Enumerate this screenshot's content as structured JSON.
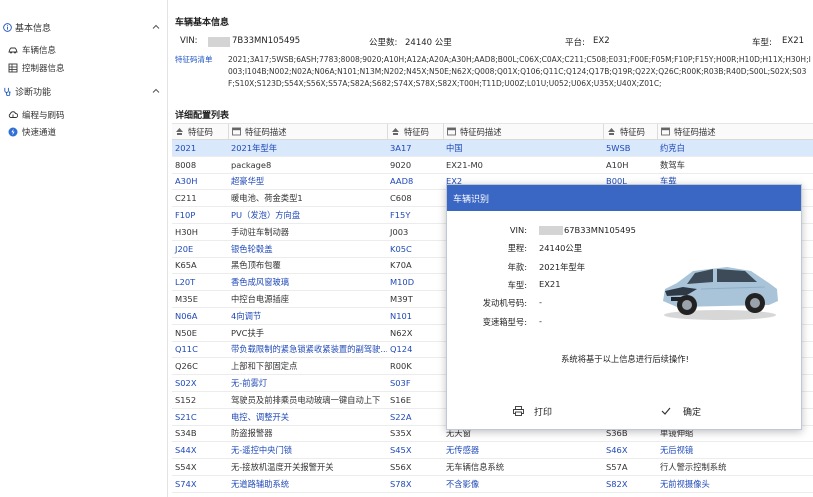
{
  "sidebar": {
    "sections": [
      {
        "label": "基本信息",
        "items": [
          {
            "label": "车辆信息"
          },
          {
            "label": "控制器信息"
          }
        ]
      },
      {
        "label": "诊断功能",
        "items": [
          {
            "label": "编程与刷码"
          },
          {
            "label": "快速通道"
          }
        ]
      }
    ]
  },
  "vehicle_info": {
    "title": "车辆基本信息",
    "vin_label": "VIN:",
    "vin_partial": "7B33MN105495",
    "mileage_label": "公里数:",
    "mileage_value": "24140 公里",
    "platform_label": "平台:",
    "platform_value": "EX2",
    "model_label": "车型:",
    "model_value": "EX21",
    "code_label": "特征码清单",
    "code_text": "2021;3A17;5WSB;6ASH;7783;8008;9020;A10H;A12A;A20A;A30H;AAD8;B00L;C06X;C0AX;C211;C508;E031;F00E;F05M;F10P;F15Y;H00R;H10D;H11X;H30H;I003;I104B;N002;N02A;N06A;N101;N13M;N202;N45X;N50E;N62X;Q008;Q01X;Q106;Q11C;Q124;Q17B;Q19R;Q22X;Q26C;R00K;R03B;R40D;S00L;S02X;S03F;S10X;S123D;S54X;S56X;S57A;S82A;S682;S74X;S78X;S82X;T00H;T11D;U00Z;L01U;U052;U06X;U35X;U40X;Z01C;"
  },
  "config_table": {
    "title": "详细配置列表",
    "headers": [
      "特征码",
      "特征码描述",
      "特征码",
      "特征码描述",
      "特征码",
      "特征码描述"
    ],
    "rows": [
      [
        "2021",
        "2021年型年",
        "3A17",
        "中国",
        "5WSB",
        "约克白"
      ],
      [
        "8008",
        "package8",
        "9020",
        "EX21-M0",
        "A10H",
        "数驾车"
      ],
      [
        "A30H",
        "超豪华型",
        "AAD8",
        "EX2",
        "B00L",
        "车载"
      ],
      [
        "C211",
        "暖电池、荷金类型1",
        "C608",
        "",
        "",
        ""
      ],
      [
        "F10P",
        "PU（发泡）方向盘",
        "F15Y",
        "",
        "",
        ""
      ],
      [
        "H30H",
        "手动驻车制动器",
        "J003",
        "",
        "",
        ""
      ],
      [
        "J20E",
        "银色轮毂盖",
        "K05C",
        "",
        "",
        ""
      ],
      [
        "K65A",
        "黑色顶布包覆",
        "K70A",
        "",
        "",
        ""
      ],
      [
        "L20T",
        "香色成风窗玻璃",
        "M10D",
        "",
        "",
        ""
      ],
      [
        "M35E",
        "中控台电源插座",
        "M39T",
        "",
        "",
        ""
      ],
      [
        "N06A",
        "4向调节",
        "N101",
        "",
        "",
        ""
      ],
      [
        "N50E",
        "PVC扶手",
        "N62X",
        "",
        "",
        ""
      ],
      [
        "Q11C",
        "带负载限制的紧急锁紧收紧装置的副驾驶...",
        "Q124",
        "",
        "",
        ""
      ],
      [
        "Q26C",
        "上部和下部固定点",
        "R00K",
        "",
        "",
        ""
      ],
      [
        "S02X",
        "无-前雾灯",
        "S03F",
        "",
        "",
        ""
      ],
      [
        "S152",
        "驾驶员及前排乘员电动玻璃一键自动上下",
        "S16E",
        "",
        "",
        ""
      ],
      [
        "S21C",
        "电控、调整开关",
        "S22A",
        "",
        "",
        ""
      ],
      [
        "S34B",
        "防盗报警器",
        "S35X",
        "无天窗",
        "S36B",
        "单镜伸缩"
      ],
      [
        "S44X",
        "无-遥控中央门锁",
        "S45X",
        "无传感器",
        "S46X",
        "无后视镜"
      ],
      [
        "S54X",
        "无-接放机温度开关报警开关",
        "S56X",
        "无车辆信息系统",
        "S57A",
        "行人警示控制系统"
      ],
      [
        "S74X",
        "无道路辅助系统",
        "S78X",
        "不含影像",
        "S82X",
        "无前视摄像头"
      ]
    ],
    "row_colors": [
      "blue",
      "dark",
      "blue",
      "dark",
      "blue",
      "dark",
      "blue",
      "dark",
      "blue",
      "dark",
      "blue",
      "dark",
      "blue",
      "dark",
      "blue",
      "dark",
      "blue",
      "dark",
      "blue",
      "dark",
      "blue"
    ]
  },
  "modal": {
    "title": "车辆识别",
    "vin_label": "VIN:",
    "vin_partial": "67B33MN105495",
    "mileage_label": "里程:",
    "mileage_value": "24140公里",
    "year_label": "年款:",
    "year_value": "2021年型年",
    "model_label": "车型:",
    "model_value": "EX21",
    "engine_label": "发动机号码:",
    "engine_value": "-",
    "gearbox_label": "变速箱型号:",
    "gearbox_value": "-",
    "message": "系统将基于以上信息进行后续操作!",
    "print_label": "打印",
    "confirm_label": "确定"
  },
  "colors": {
    "accent": "#3a66c4",
    "link": "#1f49b8",
    "selected_row": "#d9e8fb"
  }
}
